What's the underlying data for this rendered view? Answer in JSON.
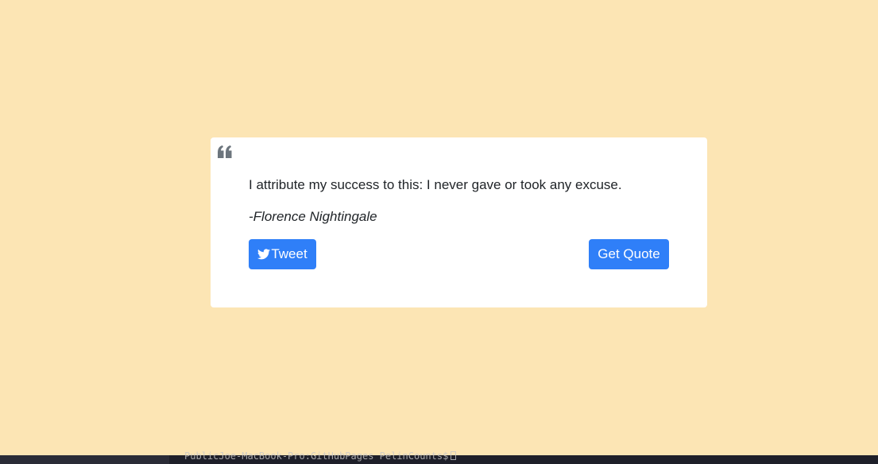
{
  "quote": {
    "icon": "quote-left-icon",
    "text": "I attribute my success to this: I never gave or took any excuse.",
    "author": "-Florence Nightingale"
  },
  "buttons": {
    "tweet_label": "Tweet",
    "tweet_icon": "twitter-icon",
    "get_quote_label": "Get Quote"
  },
  "terminal": {
    "line": "PublicJoe-MacBook-Pro:GitHubPages PelinCounts$"
  },
  "colors": {
    "background": "#fce5b4",
    "card": "#ffffff",
    "accent": "#2f7ff8",
    "quote_icon": "#6c757d"
  }
}
